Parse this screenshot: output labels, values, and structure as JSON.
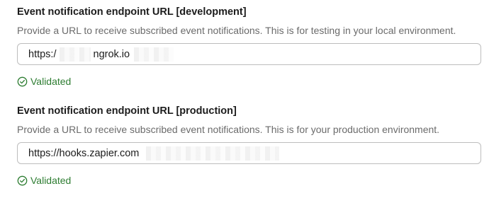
{
  "dev": {
    "title": "Event notification endpoint URL [development]",
    "description": "Provide a URL to receive subscribed event notifications. This is for testing in your local environment.",
    "url_prefix": "https:/",
    "url_suffix": "ngrok.io",
    "status": "Validated"
  },
  "prod": {
    "title": "Event notification endpoint URL [production]",
    "description": "Provide a URL to receive subscribed event notifications. This is for your production environment.",
    "url_prefix": "https://hooks.zapier.com",
    "status": "Validated"
  },
  "colors": {
    "success": "#2e7d32",
    "heading": "#1c1c1c",
    "muted": "#6b6b6b",
    "border": "#bdbdbd"
  },
  "icons": {
    "status": "check-circle-icon"
  }
}
